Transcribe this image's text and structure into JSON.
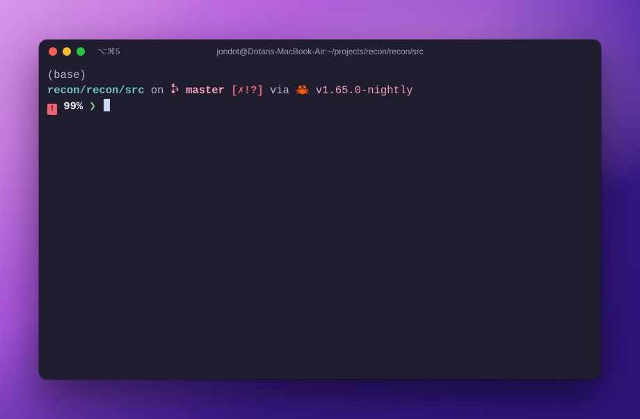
{
  "titlebar": {
    "tab_shortcut": "⌥⌘5",
    "title": "jondot@Dotans-MacBook-Air:~/projects/recon/recon/src"
  },
  "prompt": {
    "env": "(base)",
    "path": "recon/recon/src",
    "on": " on ",
    "branch": "master",
    "git_status": "[✗!?]",
    "via": " via ",
    "crab_emoji": "🦀",
    "rust_version": "v1.65.0-nightly",
    "battery_pct": "99%",
    "prompt_symbol": "❯"
  }
}
